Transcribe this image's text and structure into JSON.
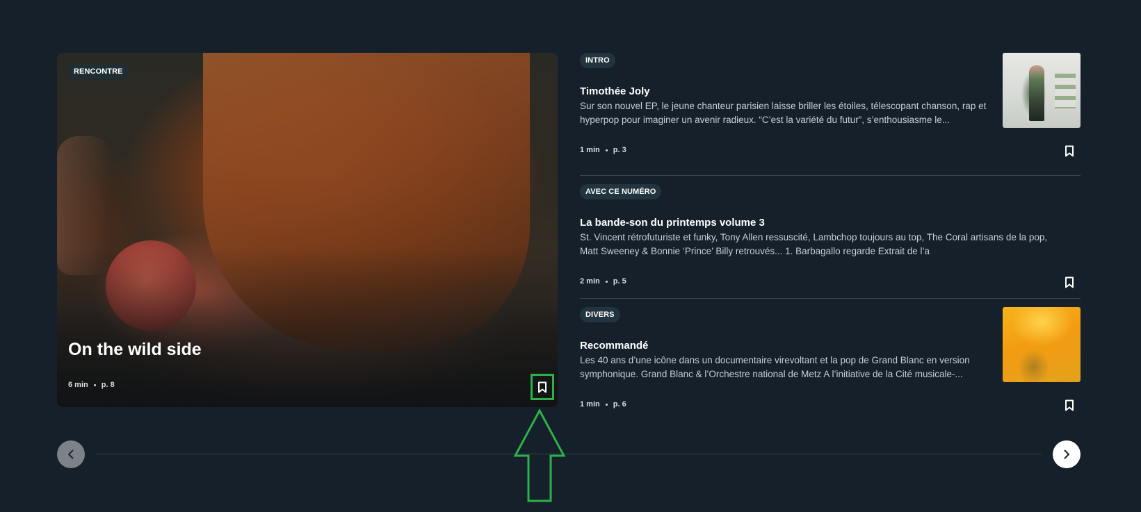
{
  "hero": {
    "tag": "RENCONTRE",
    "title": "On the wild side",
    "duration": "6 min",
    "page": "p. 8",
    "bookmark_icon": "bookmark-icon"
  },
  "articles": [
    {
      "tag": "INTRO",
      "title": "Timothée Joly",
      "description": "Sur son nouvel EP, le jeune chanteur parisien laisse briller les étoiles, télescopant chanson, rap et hyperpop pour imaginer un avenir radieux. “C’est la variété du futur”, s’enthousiasme le...",
      "duration": "1 min",
      "page": "p. 3",
      "has_thumbnail": true
    },
    {
      "tag": "AVEC CE NUMÉRO",
      "title": "La bande-son du printemps volume 3",
      "description": "St. Vincent rétrofuturiste et funky, Tony Allen ressuscité, Lambchop toujours au top, The Coral artisans de la pop, Matt Sweeney & Bonnie ‘Prince’ Billy retrouvés... 1. Barbagallo regarde Extrait de l’a",
      "duration": "2 min",
      "page": "p. 5",
      "has_thumbnail": false
    },
    {
      "tag": "DIVERS",
      "title": "Recommandé",
      "description": "Les 40 ans d’une icône dans un documentaire virevoltant et la pop de Grand Blanc en version symphonique. Grand Blanc & l’Orchestre national de Metz A l’initiative de la Cité musicale-...",
      "duration": "1 min",
      "page": "p. 6",
      "has_thumbnail": true
    }
  ],
  "carousel": {
    "prev_icon": "chevron-left-icon",
    "next_icon": "chevron-right-icon"
  },
  "colors": {
    "background": "#15202b",
    "tag_bg": "#22343f",
    "annotation": "#2db14a"
  }
}
